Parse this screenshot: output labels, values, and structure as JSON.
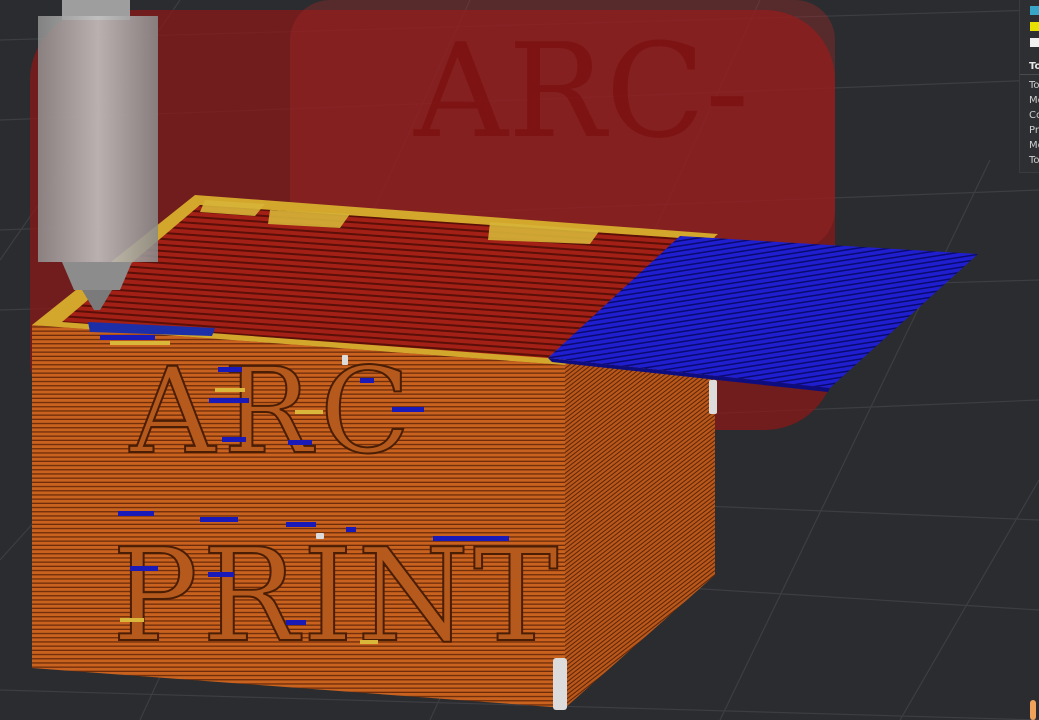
{
  "app": {
    "view": "G-code preview"
  },
  "watermark": {
    "text": "ARC-"
  },
  "model_text": {
    "line1": "ARC",
    "line2": "PRINT"
  },
  "legend": {
    "swatches": [
      {
        "name": "legend-swatch-cyan",
        "color": "#38a6c8"
      },
      {
        "name": "legend-swatch-yellow",
        "color": "#e8e000"
      },
      {
        "name": "legend-swatch-white",
        "color": "#f0f0f0"
      }
    ],
    "title": "To",
    "rows": [
      "To",
      "Mo",
      "Co",
      "Pr",
      "Mo",
      "To"
    ]
  },
  "colors": {
    "background": "#2b2c2f",
    "grid": "#3b3c40",
    "outer_wall": "#c8621e",
    "inner_wall": "#e0c23a",
    "sparse_infill": "#9a1e14",
    "bridge_infill": "#1b1bc4",
    "support": "#d0d0d0",
    "nozzle": "#a9a9a9"
  }
}
